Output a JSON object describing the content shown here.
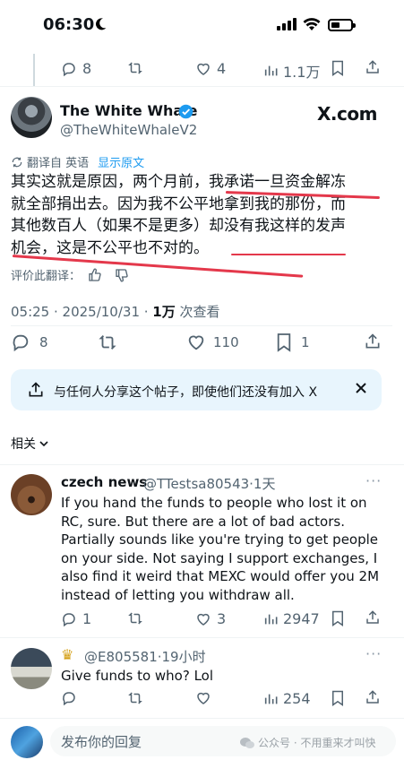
{
  "status_bar": {
    "time": "06:30"
  },
  "prev_tweet_actions": {
    "replies": "8",
    "likes": "4",
    "views": "1.1万"
  },
  "tweet": {
    "author_name": "The White Whale",
    "author_handle": "@TheWhiteWhaleV2",
    "source_label": "X.com",
    "translated_label": "翻译自 英语",
    "show_original": "显示原文",
    "text_lines": [
      "其实这就是原因，两个月前，我承诺一旦资金解冻",
      "就全部捐出去。因为我不公平地拿到我的那份，而",
      "其他数百人（如果不是更多）却没有我这样的发声",
      "机会，这是不公平也不对的。"
    ],
    "rate_translation": "评价此翻译：",
    "time": "05:25 · 2025/10/31 · ",
    "views_count": "1万",
    "views_label": " 次查看",
    "replies": "8",
    "likes": "110",
    "bookmarks": "1",
    "highlight_color": "#e4384b"
  },
  "share_prompt": {
    "text": "与任何人分享这个帖子，即使他们还没有加入 X"
  },
  "related_label": "相关",
  "replies": [
    {
      "name": "czech news",
      "handle_time": "@TTestsa80543·1天",
      "text": "If you hand the funds to people who lost it on RC, sure. But there are a lot of bad actors. Partially sounds like you're trying to get people on your side. Not saying I support exchanges, I also find it weird that MEXC would offer you 2M instead of letting you withdraw all.",
      "replies": "1",
      "likes": "3",
      "views": "2947"
    },
    {
      "name": "",
      "handle_time": "@E805581·19小时",
      "text": "Give funds to who? Lol",
      "replies": "",
      "likes": "",
      "views": "254"
    }
  ],
  "compose": {
    "placeholder": "发布你的回复"
  },
  "watermark": "公众号 · 不用重来才叫快",
  "colors": {
    "accent": "#1d9bf0",
    "muted": "#536471",
    "share_bg": "#e8f5fd"
  }
}
